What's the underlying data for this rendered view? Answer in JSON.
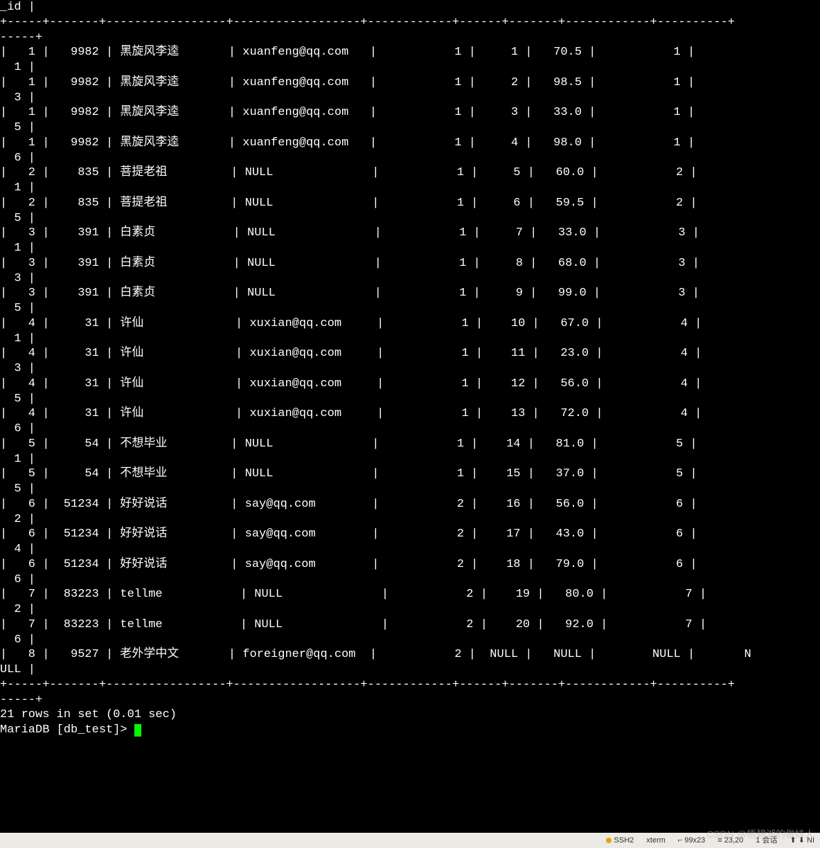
{
  "header_fragment": "_id |",
  "sep_line": "+-----+-------+-----------------+------------------+------------+------+-------+------------+----------+",
  "sep_tail": "-----+",
  "rows": [
    {
      "c1": "1",
      "c2": "9982",
      "c3": "黑旋风李逵",
      "c4": "xuanfeng@qq.com",
      "c5": "1",
      "c6": "1",
      "c7": "70.5",
      "c8": "1",
      "wrap": "1"
    },
    {
      "c1": "1",
      "c2": "9982",
      "c3": "黑旋风李逵",
      "c4": "xuanfeng@qq.com",
      "c5": "1",
      "c6": "2",
      "c7": "98.5",
      "c8": "1",
      "wrap": "3"
    },
    {
      "c1": "1",
      "c2": "9982",
      "c3": "黑旋风李逵",
      "c4": "xuanfeng@qq.com",
      "c5": "1",
      "c6": "3",
      "c7": "33.0",
      "c8": "1",
      "wrap": "5"
    },
    {
      "c1": "1",
      "c2": "9982",
      "c3": "黑旋风李逵",
      "c4": "xuanfeng@qq.com",
      "c5": "1",
      "c6": "4",
      "c7": "98.0",
      "c8": "1",
      "wrap": "6"
    },
    {
      "c1": "2",
      "c2": "835",
      "c3": "菩提老祖",
      "c4": "NULL",
      "c5": "1",
      "c6": "5",
      "c7": "60.0",
      "c8": "2",
      "wrap": "1"
    },
    {
      "c1": "2",
      "c2": "835",
      "c3": "菩提老祖",
      "c4": "NULL",
      "c5": "1",
      "c6": "6",
      "c7": "59.5",
      "c8": "2",
      "wrap": "5"
    },
    {
      "c1": "3",
      "c2": "391",
      "c3": "白素贞",
      "c4": "NULL",
      "c5": "1",
      "c6": "7",
      "c7": "33.0",
      "c8": "3",
      "wrap": "1"
    },
    {
      "c1": "3",
      "c2": "391",
      "c3": "白素贞",
      "c4": "NULL",
      "c5": "1",
      "c6": "8",
      "c7": "68.0",
      "c8": "3",
      "wrap": "3"
    },
    {
      "c1": "3",
      "c2": "391",
      "c3": "白素贞",
      "c4": "NULL",
      "c5": "1",
      "c6": "9",
      "c7": "99.0",
      "c8": "3",
      "wrap": "5"
    },
    {
      "c1": "4",
      "c2": "31",
      "c3": "许仙",
      "c4": "xuxian@qq.com",
      "c5": "1",
      "c6": "10",
      "c7": "67.0",
      "c8": "4",
      "wrap": "1"
    },
    {
      "c1": "4",
      "c2": "31",
      "c3": "许仙",
      "c4": "xuxian@qq.com",
      "c5": "1",
      "c6": "11",
      "c7": "23.0",
      "c8": "4",
      "wrap": "3"
    },
    {
      "c1": "4",
      "c2": "31",
      "c3": "许仙",
      "c4": "xuxian@qq.com",
      "c5": "1",
      "c6": "12",
      "c7": "56.0",
      "c8": "4",
      "wrap": "5"
    },
    {
      "c1": "4",
      "c2": "31",
      "c3": "许仙",
      "c4": "xuxian@qq.com",
      "c5": "1",
      "c6": "13",
      "c7": "72.0",
      "c8": "4",
      "wrap": "6"
    },
    {
      "c1": "5",
      "c2": "54",
      "c3": "不想毕业",
      "c4": "NULL",
      "c5": "1",
      "c6": "14",
      "c7": "81.0",
      "c8": "5",
      "wrap": "1"
    },
    {
      "c1": "5",
      "c2": "54",
      "c3": "不想毕业",
      "c4": "NULL",
      "c5": "1",
      "c6": "15",
      "c7": "37.0",
      "c8": "5",
      "wrap": "5"
    },
    {
      "c1": "6",
      "c2": "51234",
      "c3": "好好说话",
      "c4": "say@qq.com",
      "c5": "2",
      "c6": "16",
      "c7": "56.0",
      "c8": "6",
      "wrap": "2"
    },
    {
      "c1": "6",
      "c2": "51234",
      "c3": "好好说话",
      "c4": "say@qq.com",
      "c5": "2",
      "c6": "17",
      "c7": "43.0",
      "c8": "6",
      "wrap": "4"
    },
    {
      "c1": "6",
      "c2": "51234",
      "c3": "好好说话",
      "c4": "say@qq.com",
      "c5": "2",
      "c6": "18",
      "c7": "79.0",
      "c8": "6",
      "wrap": "6"
    },
    {
      "c1": "7",
      "c2": "83223",
      "c3": "tellme",
      "c4": "NULL",
      "c5": "2",
      "c6": "19",
      "c7": "80.0",
      "c8": "7",
      "wrap": "2"
    },
    {
      "c1": "7",
      "c2": "83223",
      "c3": "tellme",
      "c4": "NULL",
      "c5": "2",
      "c6": "20",
      "c7": "92.0",
      "c8": "7",
      "wrap": "6"
    },
    {
      "c1": "8",
      "c2": "9527",
      "c3": "老外学中文",
      "c4": "foreigner@qq.com",
      "c5": "2",
      "c6": "NULL",
      "c7": "NULL",
      "c8": "NULL",
      "wrap_text": "ULL |"
    }
  ],
  "summary": "21 rows in set (0.01 sec)",
  "prompt": "MariaDB [db_test]> ",
  "statusbar": {
    "ssh": "SSH2",
    "term": "xterm",
    "size": "99x23",
    "pos": "23,20",
    "sess": "1 会话"
  },
  "watermark": "CSDN @梧碧湖的做娃人",
  "last_row_tail": "N"
}
